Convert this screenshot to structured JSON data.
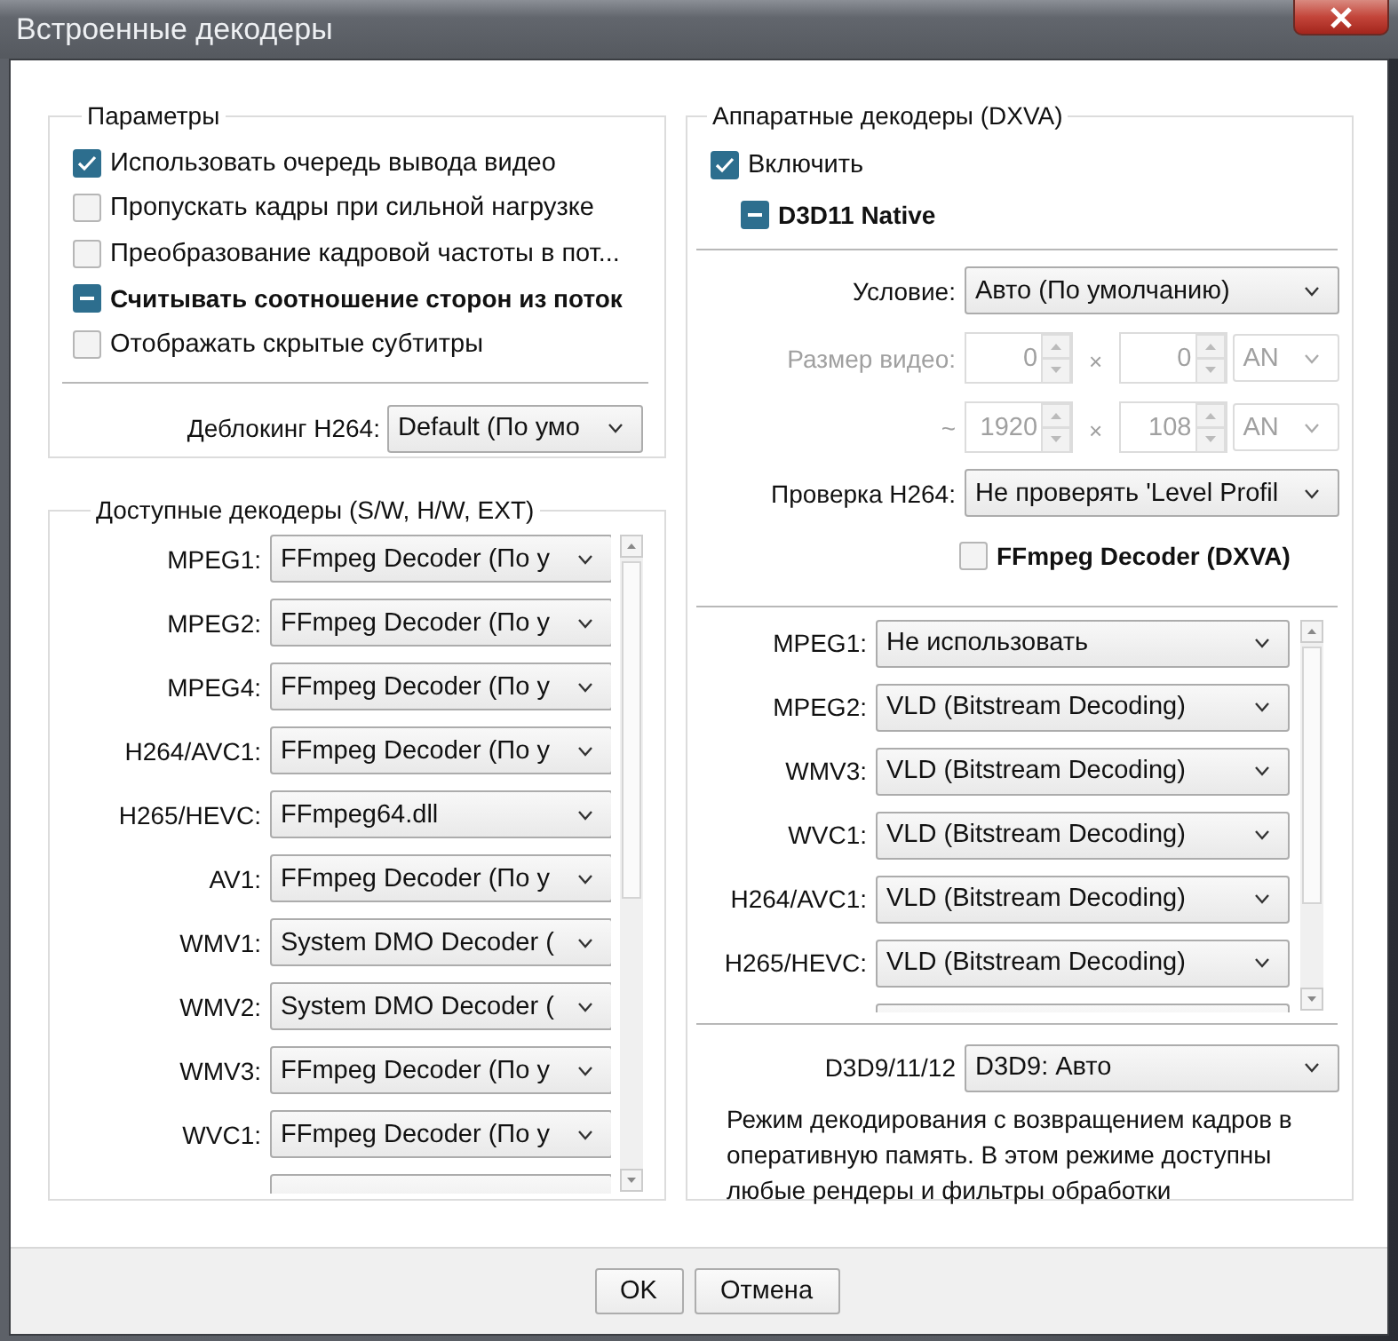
{
  "window": {
    "title": "Встроенные декодеры"
  },
  "params": {
    "title": "Параметры",
    "options": [
      {
        "label": "Использовать очередь вывода видео",
        "checked": true,
        "indeterminate": false,
        "bold": false
      },
      {
        "label": "Пропускать кадры при сильной нагрузке",
        "checked": false,
        "indeterminate": false,
        "bold": false
      },
      {
        "label": "Преобразование кадровой частоты в пот...",
        "checked": false,
        "indeterminate": false,
        "bold": false
      },
      {
        "label": "Считывать соотношение сторон из поток",
        "checked": true,
        "indeterminate": true,
        "bold": true
      },
      {
        "label": "Отображать скрытые субтитры",
        "checked": false,
        "indeterminate": false,
        "bold": false
      }
    ],
    "deblocking": {
      "label": "Деблокинг H264:",
      "value": "Default (По умо"
    }
  },
  "decoders": {
    "title": "Доступные декодеры (S/W, H/W, EXT)",
    "rows": [
      {
        "label": "MPEG1:",
        "value": "FFmpeg Decoder (По у"
      },
      {
        "label": "MPEG2:",
        "value": "FFmpeg Decoder (По у"
      },
      {
        "label": "MPEG4:",
        "value": "FFmpeg Decoder (По у"
      },
      {
        "label": "H264/AVC1:",
        "value": "FFmpeg Decoder (По у"
      },
      {
        "label": "H265/HEVC:",
        "value": "FFmpeg64.dll"
      },
      {
        "label": "AV1:",
        "value": "FFmpeg Decoder (По у"
      },
      {
        "label": "WMV1:",
        "value": "System DMO Decoder ("
      },
      {
        "label": "WMV2:",
        "value": "System DMO Decoder ("
      },
      {
        "label": "WMV3:",
        "value": "FFmpeg Decoder (По у"
      },
      {
        "label": "WVC1:",
        "value": "FFmpeg Decoder (По у"
      }
    ]
  },
  "hardware": {
    "title": "Аппаратные декодеры (DXVA)",
    "enable": {
      "label": "Включить",
      "checked": true,
      "indeterminate": false,
      "bold": false
    },
    "native": {
      "label": "D3D11 Native",
      "checked": true,
      "indeterminate": true,
      "bold": true
    },
    "condition": {
      "label": "Условие:",
      "value": "Авто (По умолчанию)"
    },
    "size_rows": [
      {
        "label": "Размер видео:",
        "from": "0",
        "sep": "×",
        "to": "0",
        "op": "AN",
        "disabled": true
      },
      {
        "label": "~",
        "from": "1920",
        "sep": "×",
        "to": "108",
        "op": "AN",
        "disabled": true
      }
    ],
    "h264_check": {
      "label": "Проверка H264:",
      "value": "Не проверять 'Level Profil"
    },
    "ffmpeg_dxva": {
      "label": "FFmpeg Decoder (DXVA)",
      "checked": false,
      "indeterminate": false,
      "bold": true
    },
    "rows": [
      {
        "label": "MPEG1:",
        "value": "Не использовать"
      },
      {
        "label": "MPEG2:",
        "value": "VLD (Bitstream Decoding)"
      },
      {
        "label": "WMV3:",
        "value": "VLD (Bitstream Decoding)"
      },
      {
        "label": "WVC1:",
        "value": "VLD (Bitstream Decoding)"
      },
      {
        "label": "H264/AVC1:",
        "value": "VLD (Bitstream Decoding)"
      },
      {
        "label": "H265/HEVC:",
        "value": "VLD (Bitstream Decoding)"
      }
    ],
    "d3d": {
      "label": "D3D9/11/12",
      "value": "D3D9: Авто"
    },
    "description": "Режим декодирования с возвращением кадров в оперативную память. В этом режиме доступны любые рендеры и фильтры обработки"
  },
  "buttons": [
    {
      "label": "OK"
    },
    {
      "label": "Отмена"
    }
  ]
}
